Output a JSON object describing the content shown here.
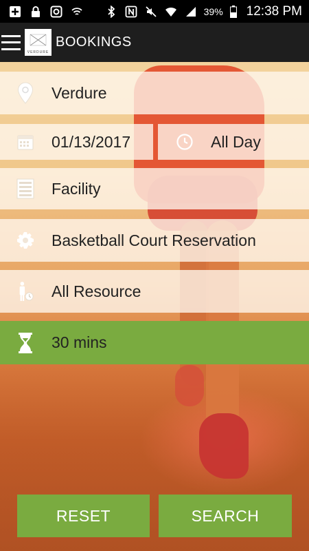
{
  "status_bar": {
    "battery_percent": "39%",
    "time": "12:38 PM",
    "icons": [
      "add-box-icon",
      "lock-icon",
      "instagram-icon",
      "wifi-shield-icon",
      "bluetooth-icon",
      "nfc-icon",
      "mute-icon",
      "wifi-icon",
      "signal-icon",
      "battery-icon"
    ]
  },
  "app_bar": {
    "title": "BOOKINGS",
    "logo_text": "VERDURE"
  },
  "form": {
    "location": "Verdure",
    "date": "01/13/2017",
    "time": "All Day",
    "category": "Facility",
    "service": "Basketball Court Reservation",
    "resource": "All Resource",
    "duration": "30 mins"
  },
  "buttons": {
    "reset": "RESET",
    "search": "SEARCH"
  },
  "colors": {
    "accent_green": "#7aab40",
    "app_bar": "#1e1e1e",
    "status_bar": "#000000"
  }
}
